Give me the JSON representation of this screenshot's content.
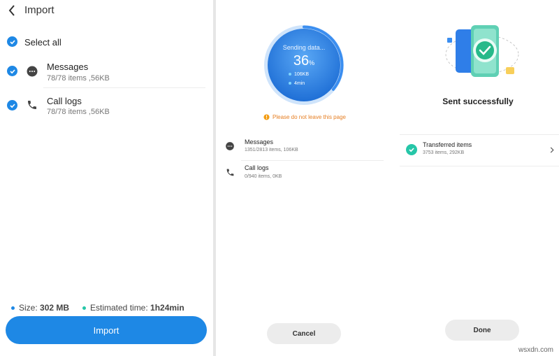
{
  "import_panel": {
    "title": "Import",
    "select_all": "Select all",
    "items": [
      {
        "label": "Messages",
        "sub": "78/78 items ,56KB"
      },
      {
        "label": "Call logs",
        "sub": "78/78 items ,56KB"
      }
    ],
    "size_label": "Size: ",
    "size_value": "302 MB",
    "eta_label": "Estimated time: ",
    "eta_value": "1h24min",
    "import_button": "Import"
  },
  "sending_panel": {
    "status": "Sending data...",
    "percent": "36",
    "percent_unit": "%",
    "progress_fraction": 0.36,
    "size": "106KB",
    "time": "4min",
    "warning": "Please do not leave this page",
    "items": [
      {
        "label": "Messages",
        "sub": "1351/2813 items, 106KB"
      },
      {
        "label": "Call logs",
        "sub": "0/940 items, 0KB"
      }
    ],
    "cancel_button": "Cancel"
  },
  "done_panel": {
    "status": "Sent successfully",
    "transferred_label": "Transferred items",
    "transferred_sub": "3753 items, 292KB",
    "done_button": "Done"
  },
  "watermark": "wsxdn.com",
  "colors": {
    "accent": "#1e88e5",
    "warning": "#f39c12",
    "success": "#26c6a8"
  }
}
